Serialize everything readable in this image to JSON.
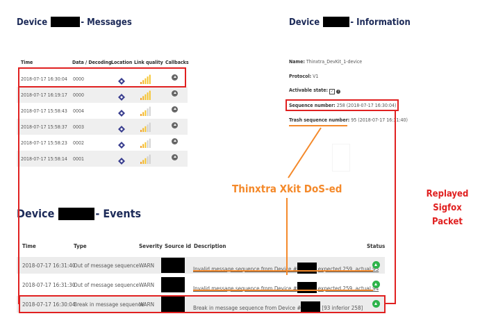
{
  "messages_panel": {
    "title_prefix": "Device",
    "title_suffix": "- Messages",
    "columns": [
      "Time",
      "Data / Decoding",
      "Location",
      "Link quality",
      "Callbacks"
    ],
    "rows": [
      {
        "time": "2018-07-17 16:30:04",
        "data": "0000",
        "link_quality": 5
      },
      {
        "time": "2018-07-17 16:19:17",
        "data": "0000",
        "link_quality": 5
      },
      {
        "time": "2018-07-17 15:58:43",
        "data": "0004",
        "link_quality": 4
      },
      {
        "time": "2018-07-17 15:58:37",
        "data": "0003",
        "link_quality": 4
      },
      {
        "time": "2018-07-17 15:58:23",
        "data": "0002",
        "link_quality": 4
      },
      {
        "time": "2018-07-17 15:58:14",
        "data": "0001",
        "link_quality": 4
      }
    ]
  },
  "info_panel": {
    "title_prefix": "Device",
    "title_suffix": "- Information",
    "name_label": "Name:",
    "name_value": "Thinxtra_DevKit_1-device",
    "protocol_label": "Protocol:",
    "protocol_value": "V1",
    "activable_label": "Activable state:",
    "sequence_label": "Sequence number:",
    "sequence_value": "258 (2018-07-17 16:30:04)",
    "trash_label": "Trash sequence number:",
    "trash_value": "95 (2018-07-17 16:31:40)"
  },
  "events_panel": {
    "title_prefix": "Device",
    "title_suffix": "- Events",
    "columns": [
      "Time",
      "Type",
      "Severity",
      "Source id",
      "Description",
      "Status"
    ],
    "rows": [
      {
        "time": "2018-07-17 16:31:40",
        "type": "Out of message sequence",
        "severity": "WARN",
        "desc_a": "Invalid message sequence from Device #",
        "desc_b": "expected 259, actual 95"
      },
      {
        "time": "2018-07-17 16:31:30",
        "type": "Out of message sequence",
        "severity": "WARN",
        "desc_a": "Invalid message sequence from Device #",
        "desc_b": "expected 259, actual 94"
      },
      {
        "time": "2018-07-17 16:30:04",
        "type": "Break in message sequence",
        "severity": "WARN",
        "desc_a": "Break in message sequence from Device #",
        "desc_b": "[93 inferior 258]"
      }
    ]
  },
  "annotations": {
    "dos_label": "Thinxtra Xkit DoS-ed",
    "replay_label_1": "Replayed Sigfox",
    "replay_label_2": "Packet",
    "accent_orange": "#f4892a",
    "accent_red": "#e02020",
    "status_green": "#2db34a"
  }
}
